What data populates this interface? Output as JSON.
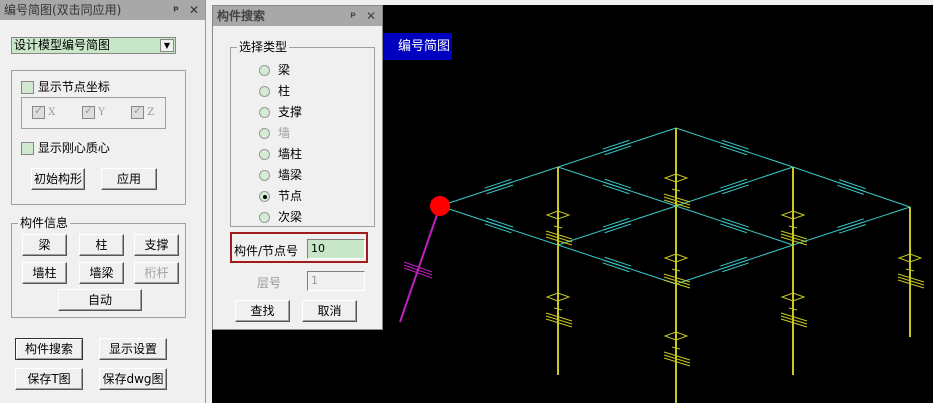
{
  "left_panel": {
    "title": "编号简图(双击同应用)",
    "pin_icon": "pin-icon",
    "close_icon": "close-icon",
    "select_value": "设计模型编号简图",
    "show_node_coords": "显示节点坐标",
    "axes": [
      "X",
      "Y",
      "Z"
    ],
    "show_rigid_mass": "显示刚心质心",
    "initial_shape": "初始构形",
    "apply": "应用",
    "component_info": {
      "label": "构件信息",
      "buttons": [
        "梁",
        "柱",
        "支撑",
        "墙柱",
        "墙梁",
        "桁杆"
      ],
      "auto": "自动"
    },
    "search_button": "构件搜索",
    "display_settings": "显示设置",
    "save_t": "保存T图",
    "save_dwg": "保存dwg图"
  },
  "search_dialog": {
    "title": "构件搜索",
    "group_label": "选择类型",
    "types": [
      {
        "label": "梁",
        "selected": false,
        "enabled": true
      },
      {
        "label": "柱",
        "selected": false,
        "enabled": true
      },
      {
        "label": "支撑",
        "selected": false,
        "enabled": true
      },
      {
        "label": "墙",
        "selected": false,
        "enabled": false
      },
      {
        "label": "墙柱",
        "selected": false,
        "enabled": true
      },
      {
        "label": "墙梁",
        "selected": false,
        "enabled": true
      },
      {
        "label": "节点",
        "selected": true,
        "enabled": true
      },
      {
        "label": "次梁",
        "selected": false,
        "enabled": true
      }
    ],
    "id_label": "构件/节点号",
    "id_value": "10",
    "floor_label": "层号",
    "floor_value": "1",
    "find": "查找",
    "cancel": "取消"
  },
  "canvas": {
    "label": "编号简图",
    "colors": {
      "background": "#000000",
      "beam": "#3cc8c8",
      "column": "#c8c81e",
      "brace": "#c020c0",
      "highlight": "#ff0000",
      "label_bg": "#0000c0"
    }
  }
}
